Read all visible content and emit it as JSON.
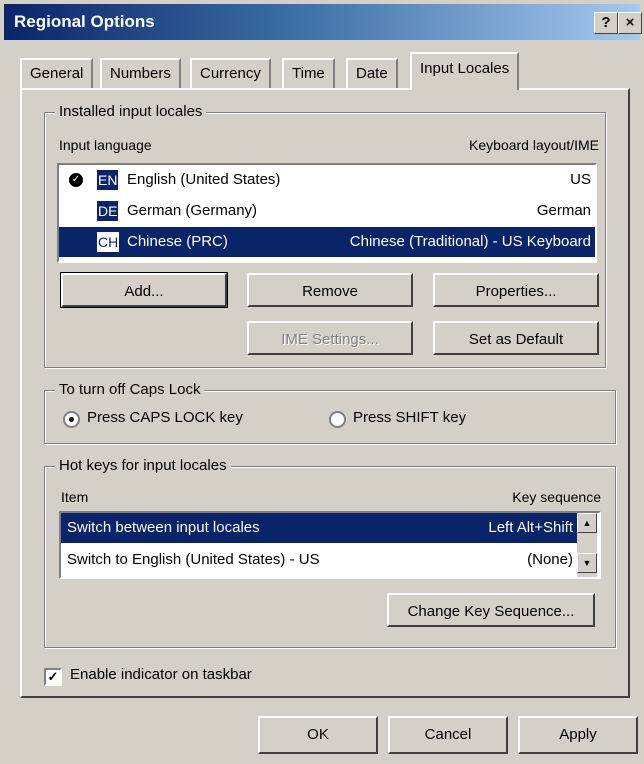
{
  "window": {
    "title": "Regional Options",
    "help_glyph": "?",
    "close_glyph": "×"
  },
  "tabs": [
    {
      "label": "General"
    },
    {
      "label": "Numbers"
    },
    {
      "label": "Currency"
    },
    {
      "label": "Time"
    },
    {
      "label": "Date"
    },
    {
      "label": "Input Locales",
      "active": true
    }
  ],
  "installed": {
    "legend": "Installed input locales",
    "col_language": "Input language",
    "col_layout": "Keyboard layout/IME",
    "active_indicator_glyph": "✓",
    "rows": [
      {
        "abbr": "EN",
        "language": "English (United States)",
        "layout": "US",
        "active": true,
        "selected": false
      },
      {
        "abbr": "DE",
        "language": "German (Germany)",
        "layout": "German",
        "active": false,
        "selected": false
      },
      {
        "abbr": "CH",
        "language": "Chinese (PRC)",
        "layout": "Chinese (Traditional) - US Keyboard",
        "active": false,
        "selected": true
      }
    ],
    "buttons": {
      "add": "Add...",
      "remove": "Remove",
      "properties": "Properties...",
      "ime_settings": "IME Settings...",
      "set_default": "Set as Default"
    }
  },
  "caps": {
    "legend": "To turn off Caps Lock",
    "option_caps": "Press CAPS LOCK key",
    "option_shift": "Press SHIFT key",
    "selected": "caps"
  },
  "hotkeys": {
    "legend": "Hot keys for input locales",
    "col_item": "Item",
    "col_sequence": "Key sequence",
    "rows": [
      {
        "item": "Switch between input locales",
        "sequence": "Left Alt+Shift",
        "selected": true
      },
      {
        "item": "Switch to English (United States) - US",
        "sequence": "(None)",
        "selected": false
      }
    ],
    "scroll_up_glyph": "▲",
    "scroll_down_glyph": "▼",
    "change_button": "Change Key Sequence..."
  },
  "indicator": {
    "label": "Enable indicator on taskbar",
    "checked": true,
    "check_glyph": "✓"
  },
  "footer": {
    "ok": "OK",
    "cancel": "Cancel",
    "apply": "Apply"
  }
}
